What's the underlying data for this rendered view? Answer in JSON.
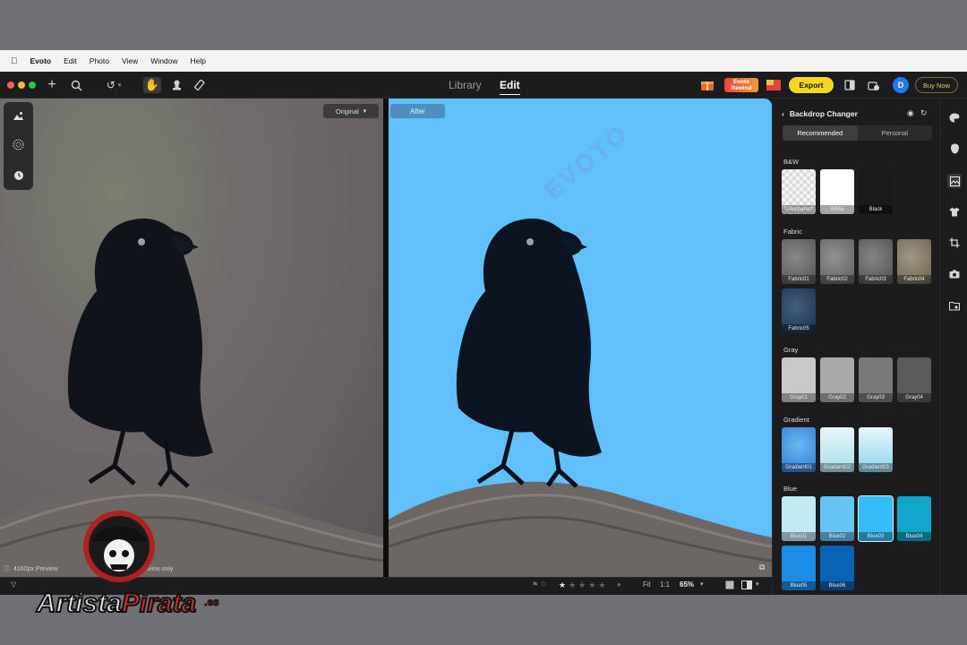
{
  "menubar": {
    "apple": "",
    "items": [
      "Evoto",
      "Edit",
      "Photo",
      "View",
      "Window",
      "Help"
    ]
  },
  "toolbar": {
    "tabs": [
      {
        "label": "Library",
        "active": false
      },
      {
        "label": "Edit",
        "active": true
      }
    ],
    "export_label": "Export",
    "buy_label": "Buy Now",
    "avatar_letter": "D",
    "promo_label": "Evoto Rewind"
  },
  "viewer": {
    "original_label": "Original",
    "after_label": "After",
    "watermark": "EVOTO",
    "info_text": "4160px Preview",
    "info_text_tail": "...view only",
    "rating_stars": 5,
    "rating_value": 1,
    "fit_label": "Fit",
    "one_to_one_label": "1:1",
    "zoom_label": "65%"
  },
  "side_panel": {
    "title": "Backdrop Changer",
    "tabs": [
      {
        "label": "Recommended",
        "active": true
      },
      {
        "label": "Personal",
        "active": false
      }
    ],
    "sections": [
      {
        "title": "B&W",
        "items": [
          {
            "label": "Transparent",
            "color": "transparent"
          },
          {
            "label": "White",
            "color": "#ffffff"
          },
          {
            "label": "Black",
            "color": "#1a1a1a"
          }
        ]
      },
      {
        "title": "Fabric",
        "items": [
          {
            "label": "Fabric01",
            "color": "#6e6e6e"
          },
          {
            "label": "Fabric02",
            "color": "#7a7a7a"
          },
          {
            "label": "Fabric03",
            "color": "#696969"
          },
          {
            "label": "Fabric04",
            "color": "#8b8165"
          },
          {
            "label": "Fabric05",
            "color": "#1c3d63"
          }
        ]
      },
      {
        "title": "Gray",
        "items": [
          {
            "label": "Gray01",
            "color": "#c9c9c9"
          },
          {
            "label": "Gray02",
            "color": "#a9a9a9"
          },
          {
            "label": "Gray03",
            "color": "#7a787a"
          },
          {
            "label": "Gray04",
            "color": "#5a5a5a"
          }
        ]
      },
      {
        "title": "Gradient",
        "items": [
          {
            "label": "Gradient01",
            "color": "#2c79d6"
          },
          {
            "label": "Gradient02",
            "color": "#a7dfe9"
          },
          {
            "label": "Gradient03",
            "color": "#8fd3ee"
          }
        ]
      },
      {
        "title": "Blue",
        "items": [
          {
            "label": "Blue01",
            "color": "#bfeaf6"
          },
          {
            "label": "Blue02",
            "color": "#66c4f6"
          },
          {
            "label": "Blue03",
            "color": "#35bdf8",
            "selected": true
          },
          {
            "label": "Blue04",
            "color": "#11a5c9"
          },
          {
            "label": "Blue05",
            "color": "#1b8de6"
          },
          {
            "label": "Blue06",
            "color": "#0a62b5"
          }
        ]
      }
    ]
  },
  "colors": {
    "accent_yellow": "#f4d91f",
    "backdrop_blue": "#60c0fb",
    "avatar_blue": "#1f79f0"
  }
}
